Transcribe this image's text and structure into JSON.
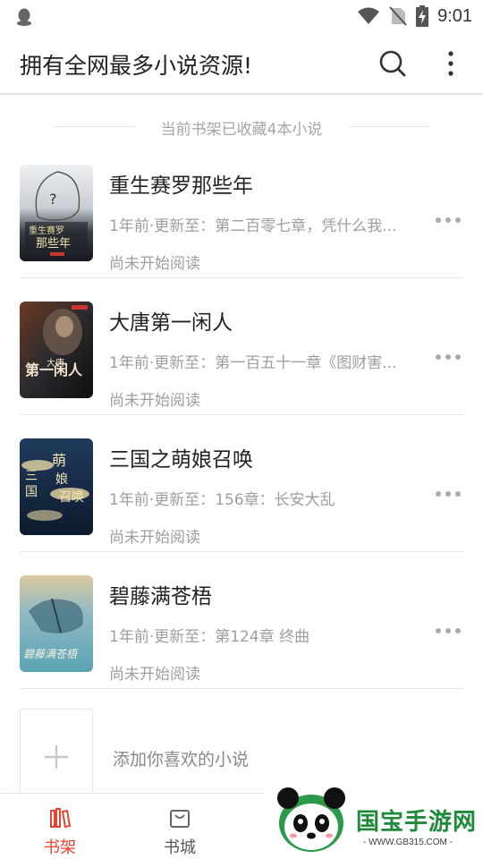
{
  "status_bar": {
    "time": "9:01",
    "icons": [
      "qq-icon",
      "wifi-icon",
      "no-sim-icon",
      "battery-charging-icon"
    ]
  },
  "header": {
    "title": "拥有全网最多小说资源!",
    "icons": [
      "search-icon",
      "more-vertical-icon"
    ]
  },
  "shelf": {
    "summary": "当前书架已收藏4本小说",
    "books": [
      {
        "title": "重生赛罗那些年",
        "update": "1年前·更新至：第二百零七章，凭什么我...",
        "status": "尚未开始阅读",
        "cover_text": "重生赛罗那些年"
      },
      {
        "title": "大唐第一闲人",
        "update": "1年前·更新至：第一百五十一章《图财害...",
        "status": "尚未开始阅读",
        "cover_text": "大唐第一闲人"
      },
      {
        "title": "三国之萌娘召唤",
        "update": "1年前·更新至：156章：长安大乱",
        "status": "尚未开始阅读",
        "cover_text": "三国萌娘召唤"
      },
      {
        "title": "碧藤满苍梧",
        "update": "1年前·更新至：第124章 终曲",
        "status": "尚未开始阅读",
        "cover_text": "碧藤满苍梧"
      }
    ],
    "add_label": "添加你喜欢的小说"
  },
  "tabs": [
    {
      "label": "书架",
      "active": true
    },
    {
      "label": "书城",
      "active": false
    }
  ],
  "watermark": {
    "name": "国宝手游网",
    "url": "- WWW.GB315.COM -"
  },
  "colors": {
    "accent": "#e8442f",
    "text_primary": "#222222",
    "text_secondary": "#9e9e9e",
    "divider": "#e5e5e5",
    "watermark_green": "#1f8a3a"
  }
}
